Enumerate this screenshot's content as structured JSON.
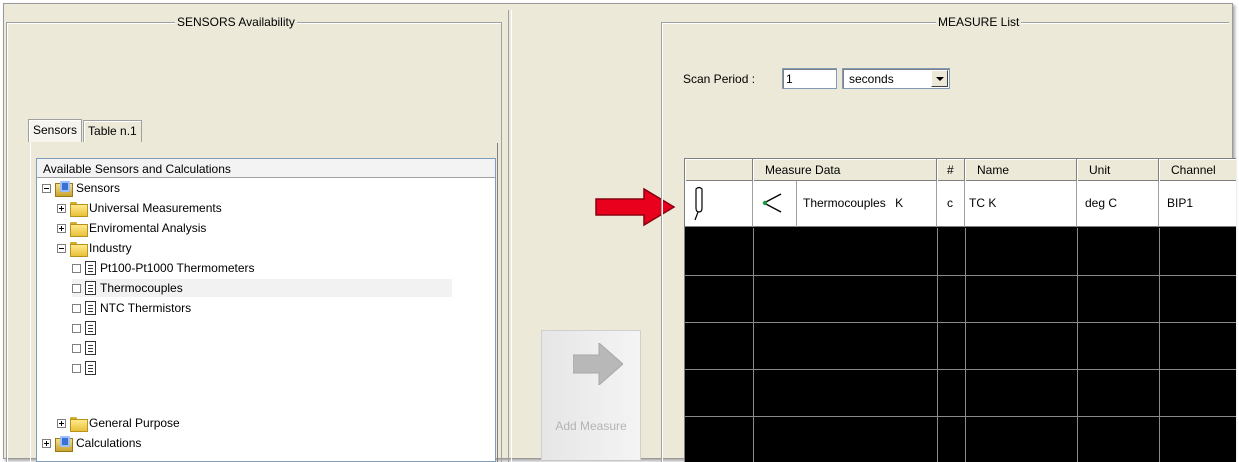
{
  "left_panel": {
    "title": "SENSORS Availability",
    "tabs": [
      {
        "label": "Sensors",
        "active": true
      },
      {
        "label": "Table n.1",
        "active": false
      }
    ],
    "tree": {
      "header": "Available Sensors and Calculations",
      "nodes": [
        {
          "label": "Sensors",
          "level": 0,
          "type": "root",
          "expander": "minus"
        },
        {
          "label": "Universal Measurements",
          "level": 1,
          "type": "folder",
          "expander": "plus"
        },
        {
          "label": "Enviromental Analysis",
          "level": 1,
          "type": "folder",
          "expander": "plus"
        },
        {
          "label": "Industry",
          "level": 1,
          "type": "folder",
          "expander": "minus"
        },
        {
          "label": "Pt100-Pt1000 Thermometers",
          "level": 2,
          "type": "item"
        },
        {
          "label": "Thermocouples",
          "level": 2,
          "type": "item"
        },
        {
          "label": "NTC Thermistors",
          "level": 2,
          "type": "item"
        },
        {
          "label": "",
          "level": 2,
          "type": "item"
        },
        {
          "label": "",
          "level": 2,
          "type": "item"
        },
        {
          "label": "",
          "level": 2,
          "type": "item"
        },
        {
          "label": "General Purpose",
          "level": 1,
          "type": "folder",
          "expander": "plus"
        },
        {
          "label": "Calculations",
          "level": 0,
          "type": "root",
          "expander": "plus"
        }
      ]
    }
  },
  "add_button": {
    "label": "Add Measure"
  },
  "right_panel": {
    "title": "MEASURE List",
    "scan": {
      "label": "Scan Period :",
      "value": "1",
      "unit": "seconds"
    },
    "grid": {
      "columns": [
        "",
        "Measure Data",
        "#",
        "Name",
        "Unit",
        "Channel"
      ],
      "rows": [
        {
          "type_label": "Thermocouples",
          "subtype": "K",
          "index": "c",
          "name": "TC K",
          "unit": "deg C",
          "channel": "BIP1"
        }
      ]
    }
  },
  "colors": {
    "grid_background": "#000000",
    "pointer_arrow": "#e8001c",
    "panel_background": "#ece9d8"
  },
  "icons": [
    "probe-icon",
    "thermocouple-icon",
    "red-pointer-arrow-icon",
    "add-arrow-icon",
    "folder-icon",
    "document-icon",
    "sensors-root-icon"
  ]
}
